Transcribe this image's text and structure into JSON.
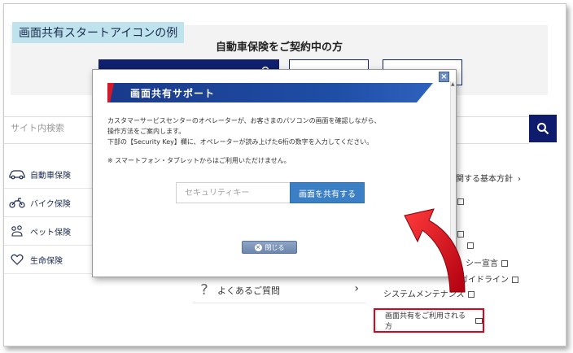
{
  "caption": "画面共有スタートアイコンの例",
  "header": {
    "contract_title": "自動車保険をご契約中の方"
  },
  "search": {
    "placeholder": "サイト内検索"
  },
  "left_nav": {
    "items": [
      {
        "label": "自動車保険",
        "icon": "car-icon"
      },
      {
        "label": "バイク保険",
        "icon": "motorcycle-icon"
      },
      {
        "label": "ペット保険",
        "icon": "pet-icon"
      },
      {
        "label": "生命保険",
        "icon": "heart-icon"
      }
    ]
  },
  "right_links": {
    "policy": "に関する基本方針",
    "privacy": "シー宣言",
    "guideline": "ィガイドライン",
    "maintenance": "システムメンテナンス"
  },
  "faq": {
    "label": "よくあるご質問"
  },
  "screen_share_link": "画面共有をご利用される方",
  "modal": {
    "title": "画面共有サポート",
    "line1": "カスタマーサービスセンターのオペレーターが、お客さまのパソコンの画面を確認しながら、",
    "line2": "操作方法をご案内します。",
    "line3": "下部の【Security Key】欄に、オペレーターが読み上げた6桁の数字を入力してください。",
    "note": "※ スマートフォン・タブレットからはご利用いただけません。",
    "key_placeholder": "セキュリティキー",
    "share_button": "画面を共有する",
    "close_button": "閉じる"
  },
  "colors": {
    "brand_navy": "#10206e",
    "share_blue": "#3b7fc4",
    "highlight_red": "#e2001a"
  }
}
